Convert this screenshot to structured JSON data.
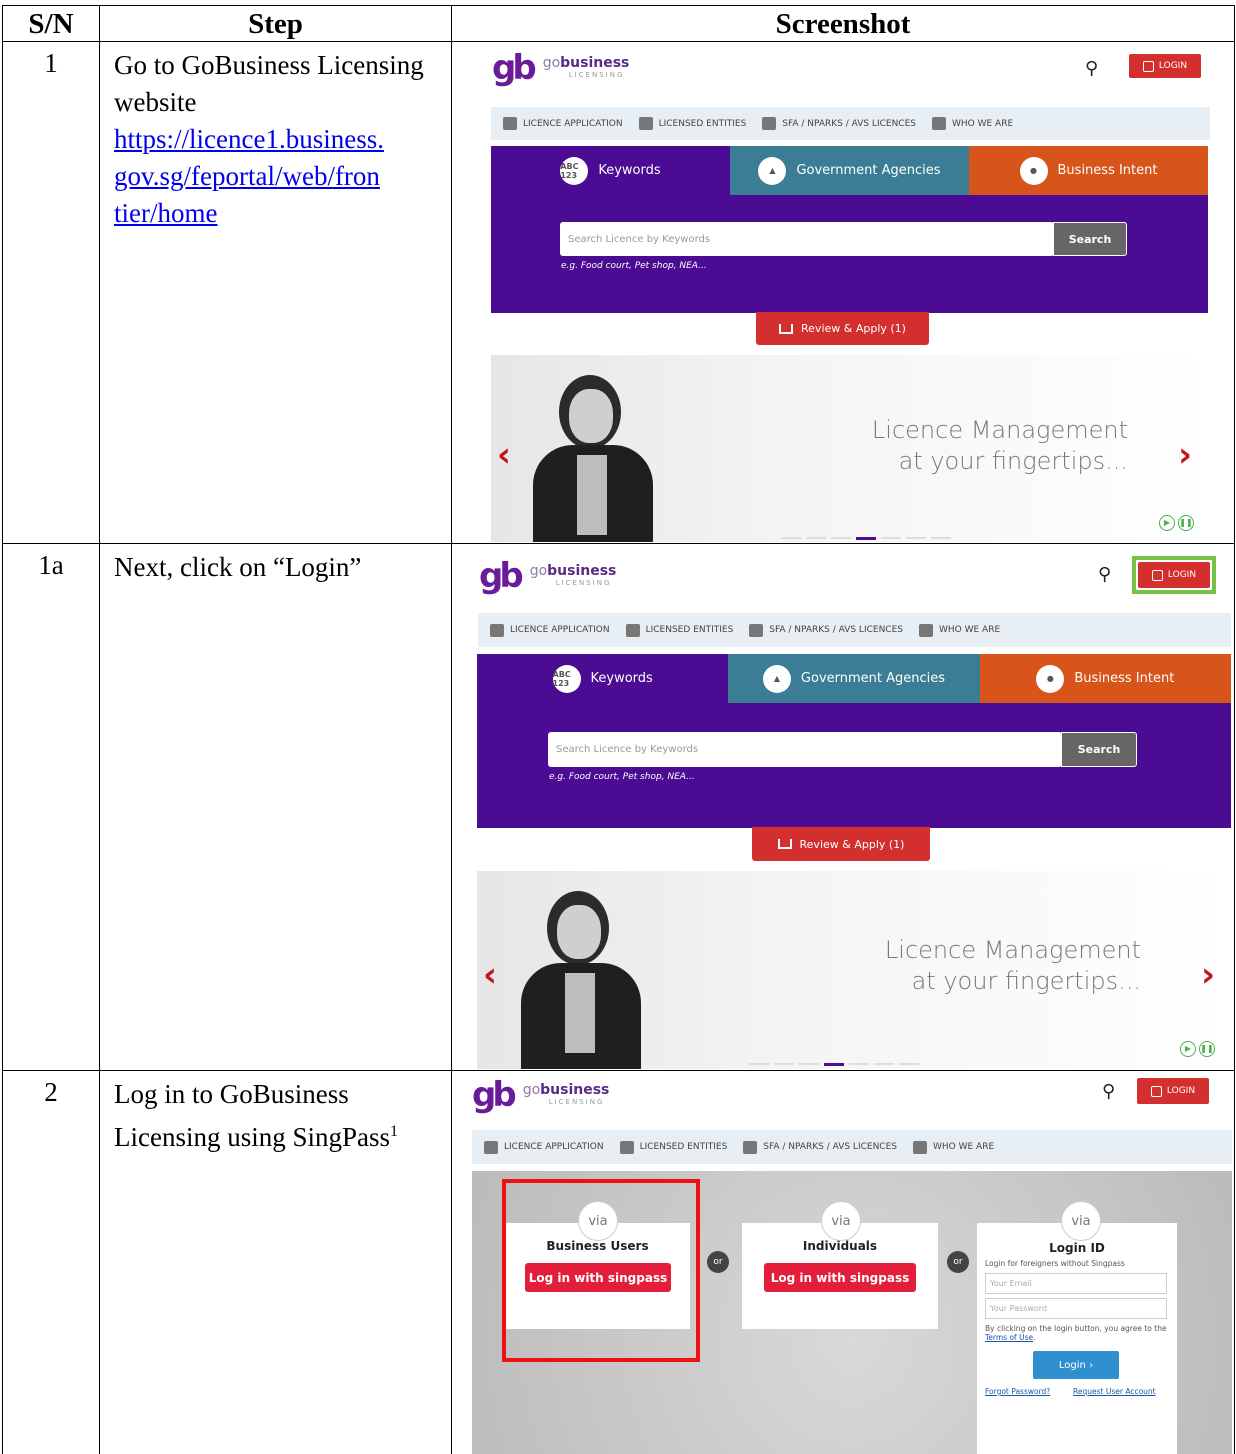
{
  "table": {
    "headers": [
      "S/N",
      "Step",
      "Screenshot"
    ],
    "rows": [
      {
        "sn": "1",
        "step_text": "Go to GoBusiness Licensing website",
        "link": "https://licence1.business.gov.sg/feportal/web/frontier/home",
        "link_lines": [
          "https://licence1.business.",
          "gov.sg/feportal/web/fron",
          "tier/home"
        ]
      },
      {
        "sn": "1a",
        "step_text": "Next, click on “Login”"
      },
      {
        "sn": "2",
        "step_text": "Log in to GoBusiness Licensing using SingPass",
        "footnote": "1"
      }
    ]
  },
  "site": {
    "logo_mark": "gb",
    "logo_go": "go",
    "logo_business": "business",
    "logo_sub": "LICENSING",
    "login_label": "LOGIN",
    "nav": [
      "LICENCE APPLICATION",
      "LICENSED ENTITIES",
      "SFA / NPARKS / AVS LICENCES",
      "WHO WE ARE"
    ],
    "tabs": [
      "Keywords",
      "Government Agencies",
      "Business Intent"
    ],
    "tab_icon_text": "ABC 123",
    "search_placeholder": "Search Licence by Keywords",
    "search_button": "Search",
    "search_example": "e.g. Food court, Pet shop, NEA...",
    "review_button": "Review & Apply (1)",
    "banner_line1": "Licence Management",
    "banner_line2": "at your fingertips..."
  },
  "login_page": {
    "via": "via",
    "or": "or",
    "business_users": "Business Users",
    "individuals": "Individuals",
    "singpass_button": "Log in with singpass",
    "login_id_title": "Login ID",
    "login_id_sub": "Login for foreigners without Singpass",
    "email_placeholder": "Your Email",
    "password_placeholder": "Your Password",
    "terms_prefix": "By clicking on the login button, you agree to the",
    "terms_link": "Terms of Use",
    "login_button": "Login",
    "forgot": "Forgot Password?",
    "request": "Request User Account"
  },
  "colors": {
    "purple": "#4b0c93",
    "teal": "#3a7d94",
    "orange": "#d7541a",
    "red": "#d32f2f",
    "highlight_green": "#7cc242",
    "highlight_red": "#e11111"
  }
}
